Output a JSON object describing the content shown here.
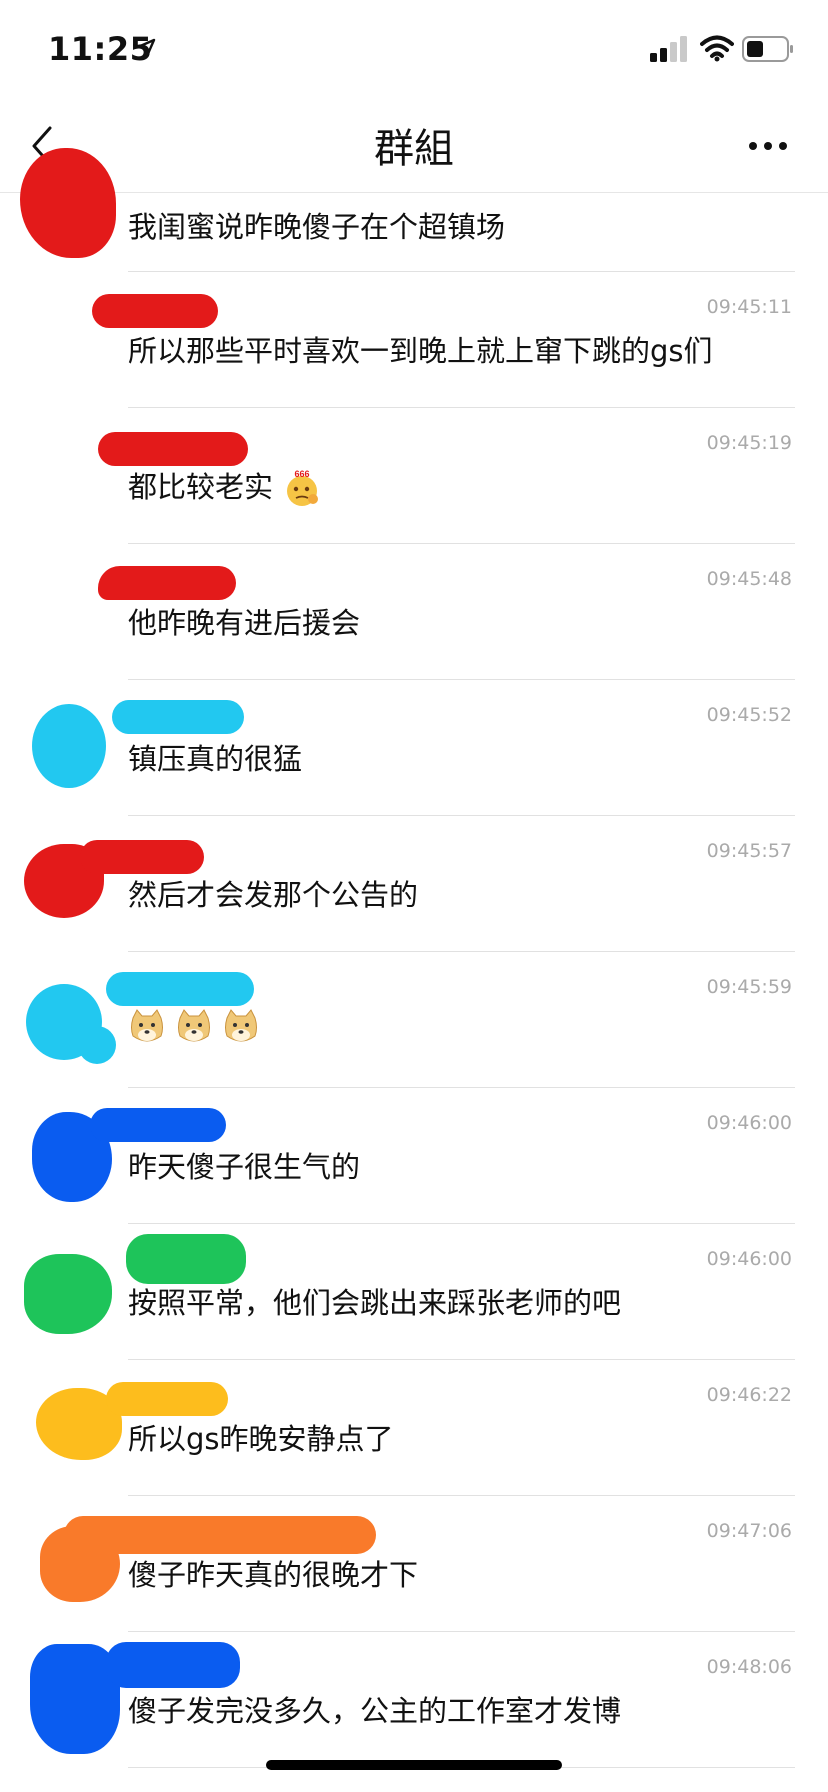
{
  "status_bar": {
    "time": "11:25"
  },
  "nav": {
    "title": "群組"
  },
  "messages": [
    {
      "time": "",
      "text": "我闺蜜说昨晚傻子在个超镇场",
      "color": "#e31a1a"
    },
    {
      "time": "09:45:11",
      "text": "所以那些平时喜欢一到晚上就上窜下跳的gs们",
      "color": "#e31a1a"
    },
    {
      "time": "09:45:19",
      "text": "都比较老实",
      "emoji": "thinking-666-emoji",
      "color": "#e31a1a"
    },
    {
      "time": "09:45:48",
      "text": "他昨晚有进后援会",
      "color": "#e31a1a"
    },
    {
      "time": "09:45:52",
      "text": "镇压真的很猛",
      "color": "#22c8f0"
    },
    {
      "time": "09:45:57",
      "text": "然后才会发那个公告的",
      "color": "#e31a1a"
    },
    {
      "time": "09:45:59",
      "text": "",
      "emoji": "doge-emoji-x3",
      "color": "#22c8f0"
    },
    {
      "time": "09:46:00",
      "text": "昨天傻子很生气的",
      "color": "#0a5cf0"
    },
    {
      "time": "09:46:00",
      "text": "按照平常，他们会跳出来踩张老师的吧",
      "color": "#1ec45a"
    },
    {
      "time": "09:46:22",
      "text": "所以gs昨晚安静点了",
      "color": "#fdbd1d"
    },
    {
      "time": "09:47:06",
      "text": "傻子昨天真的很晚才下",
      "color": "#f97a2a"
    },
    {
      "time": "09:48:06",
      "text": "傻子发完没多久，公主的工作室才发博",
      "color": "#0a5cf0"
    }
  ]
}
